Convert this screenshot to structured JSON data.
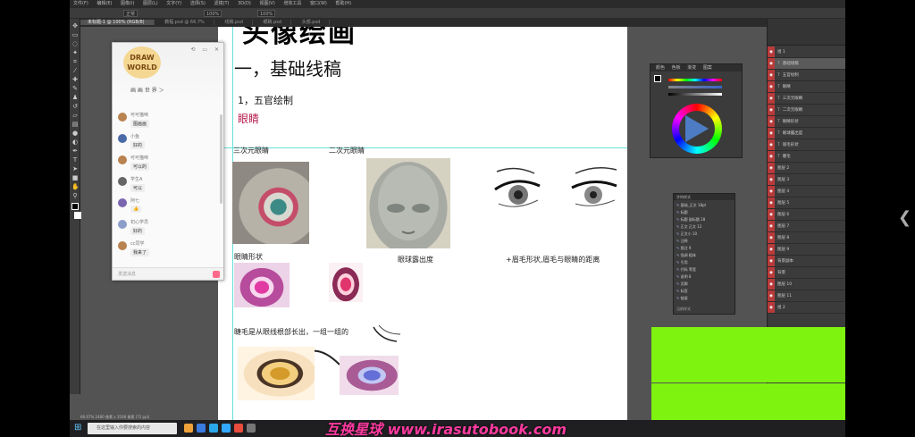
{
  "menubar": {
    "items": [
      "文件(F)",
      "编辑(E)",
      "图像(I)",
      "图层(L)",
      "文字(Y)",
      "选择(S)",
      "滤镜(T)",
      "3D(D)",
      "视图(V)",
      "增效工具",
      "窗口(W)",
      "帮助(H)"
    ]
  },
  "options": {
    "mode": "正常",
    "opacity": "100%",
    "flow": "100%"
  },
  "tabs": [
    "未标题-1 @ 100% (RGB/8)",
    "教程.psd @ 66.7%",
    "线稿.psd",
    "眼睛.psd",
    "头部.psd"
  ],
  "canvas": {
    "big_title": "头像绘画",
    "h1": "一，基础线稿",
    "h2": "1，五官绘制",
    "h3": "眼睛",
    "label_3d": "三次元眼睛",
    "label_2d": "二次元眼睛",
    "label_shape": "眼睛形状",
    "label_ball": "眼球露出度",
    "label_brow": "+眉毛形状,眉毛与眼睛的距离",
    "label_lash": "睫毛是从眼线根部长出，一组一组的"
  },
  "chat": {
    "logo_line1": "DRAW",
    "logo_line2": "WORLD",
    "controls": "⟲ ▭ ✕",
    "group_name": "画 画 世 界 ＞",
    "messages": [
      {
        "name": "可可猫咪",
        "text": "图画画"
      },
      {
        "name": "小鱼",
        "text": "好的"
      },
      {
        "name": "可可猫咪",
        "text": "可以的"
      },
      {
        "name": "学生A",
        "text": "可以"
      },
      {
        "name": "阿七",
        "text": "👍"
      },
      {
        "name": "初心学员",
        "text": "好的"
      },
      {
        "name": "cc同学",
        "text": "我来了"
      }
    ],
    "input_placeholder": "发送消息"
  },
  "color_panel": {
    "tabs": [
      "颜色",
      "色板",
      "渐变",
      "图案"
    ]
  },
  "char_panel": {
    "title": "字符样式",
    "rows": [
      "基础_正文 18pt",
      "标题",
      "标题 副标题 28",
      "正文 正文 12",
      "正文小 10",
      "注释",
      "图注 9",
      "强调 粗体",
      "引用",
      "代码 等宽",
      "说明 8",
      "页脚",
      "标签",
      "链接"
    ],
    "footer": "当前样式"
  },
  "layers": {
    "items": [
      "组 1",
      "基础线稿",
      "五官绘制",
      "眼睛",
      "三次元眼睛",
      "二次元眼睛",
      "眼睛形状",
      "眼球露出度",
      "眉毛形状",
      "睫毛",
      "图层 2",
      "图层 3",
      "图层 4",
      "图层 5",
      "图层 6",
      "图层 7",
      "图层 8",
      "图层 9",
      "背景副本",
      "背景",
      "图层 10",
      "图层 11",
      "组 2"
    ]
  },
  "status": "66.67%  2480 像素 x 3508 像素 (72 ppi)",
  "taskbar": {
    "search_placeholder": "在这里输入你要搜索的内容"
  },
  "watermark": "互换星球 www.irasutobook.com",
  "side_arrow": "❮",
  "colors": {
    "ps_bg": "#535353",
    "accent_heading": "#b5174a",
    "guide": "#3fd8d0",
    "green_overlay": "#7ef30f",
    "watermark": "#ff3aa0"
  }
}
